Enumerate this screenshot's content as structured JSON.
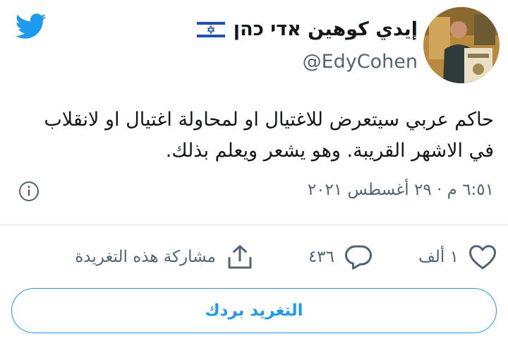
{
  "header": {
    "bird_icon": "twitter-bird-icon",
    "display_name": "إيدي كوهين אדי כהן",
    "flag_icon": "israel-flag-icon",
    "handle": "@EdyCohen",
    "avatar_icon": "profile-avatar"
  },
  "tweet": {
    "text": "حاكم عربي سيتعرض للاغتيال او لمحاولة اغتيال او لانقلاب في الاشهر القريبة. وهو يشعر ويعلم بذلك.",
    "timestamp": "٦:٥١ م · ٢٩ أغسطس ٢٠٢١",
    "info_icon": "info-icon"
  },
  "actions": {
    "like_count": "١ ألف",
    "reply_count": "٤٣٦",
    "share_label": "مشاركة هذه التغريدة",
    "reply_button_label": "التغريد بردك"
  },
  "colors": {
    "twitter_blue": "#1d9bf0",
    "secondary_text": "#536471",
    "divider": "#e1e8ed"
  }
}
